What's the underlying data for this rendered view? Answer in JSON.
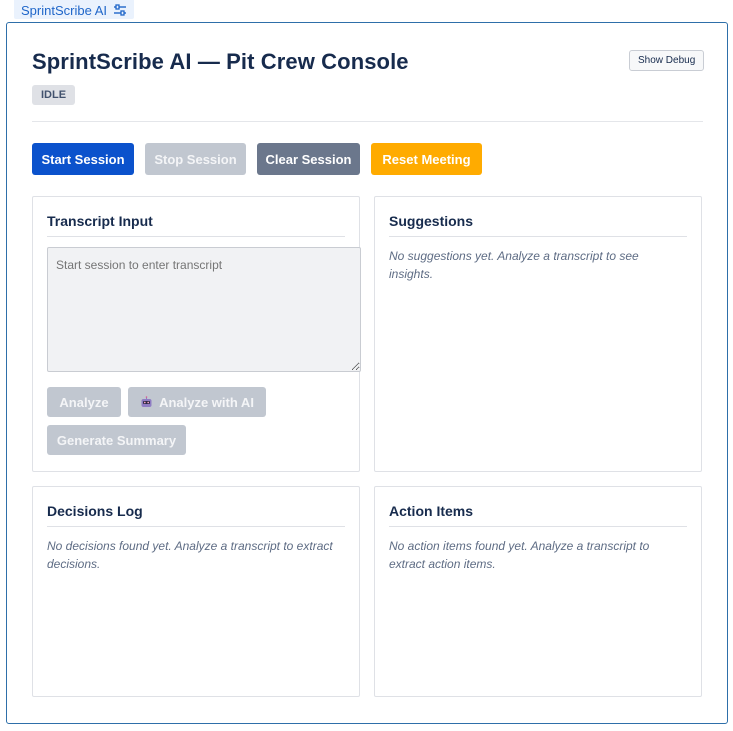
{
  "app_tab": {
    "label": "SprintScribe AI",
    "icon": "sliders-icon"
  },
  "header": {
    "title": "SprintScribe AI — Pit Crew Console",
    "status": "IDLE",
    "debug_button": "Show Debug"
  },
  "toolbar": {
    "start": "Start Session",
    "stop": "Stop Session",
    "clear": "Clear Session",
    "reset": "Reset Meeting"
  },
  "transcript": {
    "heading": "Transcript Input",
    "placeholder": "Start session to enter transcript",
    "analyze": "Analyze",
    "analyze_ai": "Analyze with AI",
    "summary": "Generate Summary"
  },
  "suggestions": {
    "heading": "Suggestions",
    "empty_line1": "No suggestions yet. Analyze a transcript to see",
    "empty_line2": "insights."
  },
  "decisions": {
    "heading": "Decisions Log",
    "empty_line1": "No decisions found yet. Analyze a transcript to extract",
    "empty_line2": "decisions."
  },
  "actions": {
    "heading": "Action Items",
    "empty_line1": "No action items found yet. Analyze a transcript to",
    "empty_line2": "extract action items."
  },
  "colors": {
    "primary": "#0b52cc",
    "disabled": "#c1c7d0",
    "neutral": "#6b778c",
    "warning": "#ffab00",
    "frame_border": "#2e6fa9"
  }
}
